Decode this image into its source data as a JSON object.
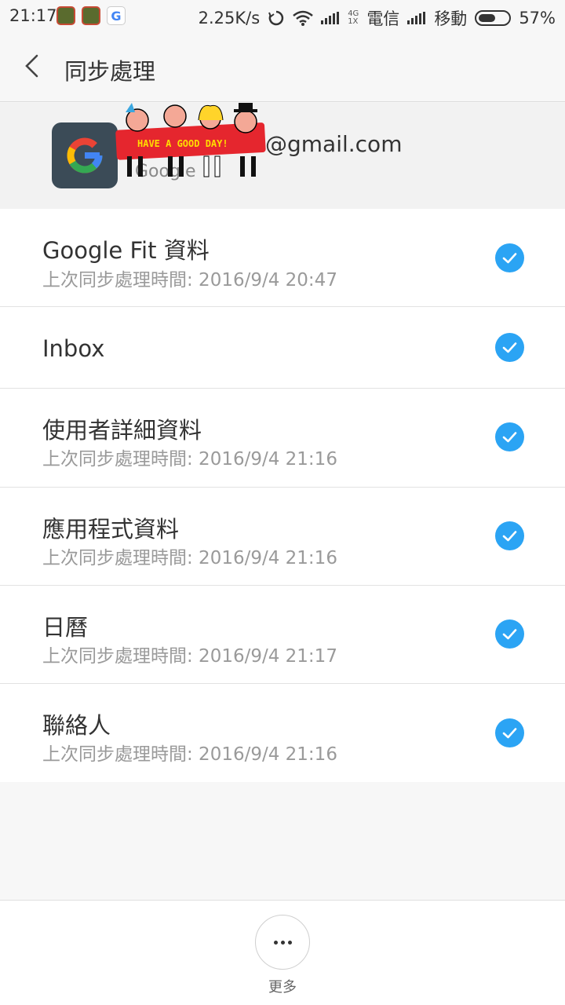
{
  "status": {
    "time": "21:17",
    "speed": "2.25K/s",
    "net_top": "4G",
    "net_bottom": "1X",
    "carrier1": "電信",
    "carrier2": "移動",
    "battery": "57%",
    "battery_level": 0.57
  },
  "header": {
    "title": "同步處理"
  },
  "account": {
    "email": "@gmail.com",
    "provider": "Google",
    "sticker_text": "HAVE A GOOD DAY!"
  },
  "sync_items": [
    {
      "name": "Google Fit 資料",
      "last_sync": "上次同步處理時間: 2016/9/4 20:47",
      "checked": true
    },
    {
      "name": "Inbox",
      "last_sync": "",
      "checked": true
    },
    {
      "name": "使用者詳細資料",
      "last_sync": "上次同步處理時間: 2016/9/4 21:16",
      "checked": true
    },
    {
      "name": "應用程式資料",
      "last_sync": "上次同步處理時間: 2016/9/4 21:16",
      "checked": true
    },
    {
      "name": "日曆",
      "last_sync": "上次同步處理時間: 2016/9/4 21:17",
      "checked": true
    },
    {
      "name": "聯絡人",
      "last_sync": "上次同步處理時間: 2016/9/4 21:16",
      "checked": true
    }
  ],
  "footer": {
    "more_label": "更多"
  },
  "colors": {
    "accent": "#2ba4f4",
    "background": "#f7f7f7"
  }
}
